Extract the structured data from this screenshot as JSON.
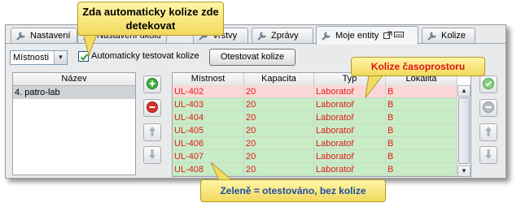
{
  "tabs": [
    {
      "label": "Nastavení"
    },
    {
      "label": "Nastavení ukolu"
    },
    {
      "label": "Vrstvy"
    },
    {
      "label": "Zprávy"
    },
    {
      "label": "Moje entity"
    },
    {
      "label": "Kolize"
    }
  ],
  "toolbar": {
    "dropdown_value": "Místnosti",
    "checkbox_label": "Automaticky testovat kolize",
    "checkbox_checked": true,
    "test_button_label": "Otestovat kolize"
  },
  "left_list": {
    "header": "Název",
    "items": [
      "4. patro-lab"
    ]
  },
  "grid": {
    "columns": [
      "Místnost",
      "Kapacita",
      "Typ",
      "Lokalita"
    ],
    "rows": [
      {
        "room": "UL-402",
        "capacity": "20",
        "type": "Laboratoř",
        "location": "B",
        "state": "collision"
      },
      {
        "room": "UL-403",
        "capacity": "20",
        "type": "Laboratoř",
        "location": "B",
        "state": "ok"
      },
      {
        "room": "UL-404",
        "capacity": "20",
        "type": "Laboratoř",
        "location": "B",
        "state": "ok"
      },
      {
        "room": "UL-405",
        "capacity": "20",
        "type": "Laboratoř",
        "location": "B",
        "state": "ok"
      },
      {
        "room": "UL-406",
        "capacity": "20",
        "type": "Laboratoř",
        "location": "B",
        "state": "ok"
      },
      {
        "room": "UL-407",
        "capacity": "20",
        "type": "Laboratoř",
        "location": "B",
        "state": "ok"
      },
      {
        "room": "UL-408",
        "capacity": "20",
        "type": "Laboratoř",
        "location": "B",
        "state": "ok"
      }
    ]
  },
  "callouts": {
    "auto": "Zda automaticky kolize zde detekovat",
    "collision": "Kolize časoprostoru",
    "green": "Zeleně = otestováno, bez kolize"
  },
  "colors": {
    "ok_row": "#c8ecc6",
    "collision_row": "#fbd7d7",
    "text": "#e01b1b",
    "callout": "#f5e27a"
  }
}
